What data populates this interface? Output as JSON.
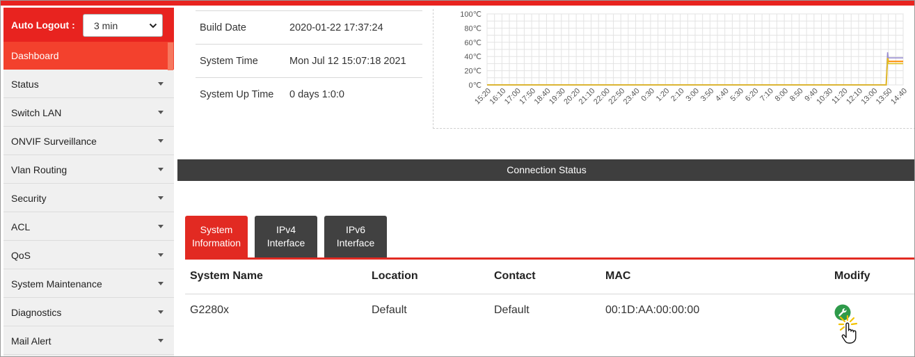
{
  "header": {
    "auto_logout_label": "Auto Logout :",
    "auto_logout_value": "3 min"
  },
  "sidebar": {
    "items": [
      {
        "label": "Dashboard",
        "active": true
      },
      {
        "label": "Status"
      },
      {
        "label": "Switch LAN"
      },
      {
        "label": "ONVIF Surveillance"
      },
      {
        "label": "Vlan Routing"
      },
      {
        "label": "Security"
      },
      {
        "label": "ACL"
      },
      {
        "label": "QoS"
      },
      {
        "label": "System Maintenance"
      },
      {
        "label": "Diagnostics"
      },
      {
        "label": "Mail Alert"
      }
    ]
  },
  "system_info": [
    {
      "key": "Build Date",
      "value": "2020-01-22 17:37:24"
    },
    {
      "key": "System Time",
      "value": "Mon Jul 12 15:07:18 2021"
    },
    {
      "key": "System Up Time",
      "value": "0 days 1:0:0"
    }
  ],
  "chart_data": {
    "type": "line",
    "ylim": [
      0,
      100
    ],
    "yticks": [
      "0℃",
      "20℃",
      "40℃",
      "60℃",
      "80℃",
      "100℃"
    ],
    "categories": [
      "15:20",
      "16:10",
      "17:00",
      "17:50",
      "18:40",
      "19:30",
      "20:20",
      "21:10",
      "22:00",
      "22:50",
      "23:40",
      "0:30",
      "1:20",
      "2:10",
      "3:00",
      "3:50",
      "4:40",
      "5:30",
      "6:20",
      "7:10",
      "8:00",
      "8:50",
      "9:40",
      "10:30",
      "11:20",
      "12:10",
      "13:00",
      "13:50",
      "14:40"
    ],
    "grid": true,
    "series": [
      {
        "color": "#ff8c00",
        "values": [
          0,
          0,
          0,
          0,
          0,
          0,
          0,
          0,
          0,
          0,
          0,
          0,
          0,
          0,
          0,
          0,
          0,
          0,
          0,
          0,
          0,
          0,
          0,
          0,
          0,
          0,
          0,
          33,
          33
        ]
      },
      {
        "color": "#9b8fd0",
        "values": [
          0,
          0,
          0,
          0,
          0,
          0,
          0,
          0,
          0,
          0,
          0,
          0,
          0,
          0,
          0,
          0,
          0,
          0,
          0,
          0,
          0,
          0,
          0,
          0,
          0,
          0,
          0,
          38,
          38
        ]
      },
      {
        "color": "#e0c020",
        "values": [
          0,
          0,
          0,
          0,
          0,
          0,
          0,
          0,
          0,
          0,
          0,
          0,
          0,
          0,
          0,
          0,
          0,
          0,
          0,
          0,
          0,
          0,
          0,
          0,
          0,
          0,
          0,
          30,
          30
        ]
      }
    ]
  },
  "connection_status": {
    "title": "Connection Status",
    "tabs": [
      {
        "line1": "System",
        "line2": "Information",
        "active": true
      },
      {
        "line1": "IPv4",
        "line2": "Interface"
      },
      {
        "line1": "IPv6",
        "line2": "Interface"
      }
    ],
    "columns": [
      "System Name",
      "Location",
      "Contact",
      "MAC",
      "Modify"
    ],
    "rows": [
      {
        "system_name": "G2280x",
        "location": "Default",
        "contact": "Default",
        "mac": "00:1D:AA:00:00:00"
      }
    ]
  },
  "colors": {
    "brand_red": "#e8231f",
    "active_menu": "#f3412d",
    "dark_bar": "#3e3e3e",
    "modify_icon": "#2e9a4a"
  },
  "icons": {
    "modify": "wrench-icon",
    "dropdown": "chevron-down-icon",
    "cursor": "hand-pointer-icon"
  }
}
